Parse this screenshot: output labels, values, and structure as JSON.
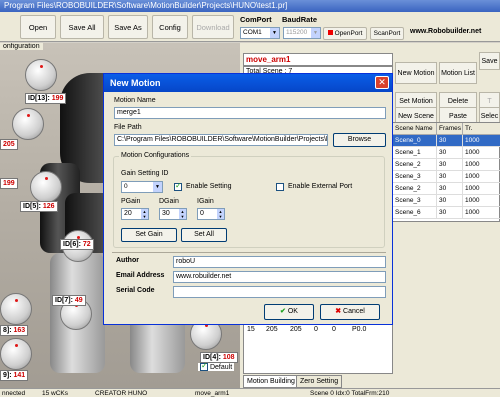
{
  "window": {
    "title": "Program Files\\ROBOBUILDER\\Software\\MotionBuilder\\Projects\\HUNO\\test1.pr]"
  },
  "toolbar": {
    "open": "Open",
    "save_all": "Save All",
    "save_as": "Save As",
    "config": "Config",
    "download": "Download",
    "comport_label": "ComPort",
    "baudrate_label": "BaudRate",
    "comport_value": "COM1",
    "baudrate_value": "115200",
    "open_port": "OpenPort",
    "scan_port": "ScanPort",
    "website": "www.Robobuilder.net"
  },
  "robot": {
    "config_label": "onfiguration",
    "servos": [
      {
        "id": "ID[13]",
        "value": "199"
      },
      {
        "id": "ID[5]",
        "value": "126"
      },
      {
        "id": "ID[6]",
        "value": "72"
      },
      {
        "id": "ID[7]",
        "value": "49"
      },
      {
        "id": "]",
        "value": "199"
      },
      {
        "id": "]",
        "value": "205"
      },
      {
        "id": "8]",
        "value": "163"
      },
      {
        "id": "9]",
        "value": "141"
      },
      {
        "id": "ID[4]",
        "value": "108"
      }
    ],
    "default_label": "Default"
  },
  "motion": {
    "name": "move_arm1",
    "total_scene": "Total Scene : 7",
    "buttons": {
      "new_motion": "New Motion",
      "motion_list": "Motion List",
      "save": "Save",
      "set_motion": "Set Motion",
      "delete": "Delete",
      "t": "T",
      "new_scene": "New Scene",
      "paste": "Paste",
      "select": "Selec"
    },
    "grid": {
      "headers": [
        "Scene Name",
        "Frames",
        "Tr. Time[ms]"
      ],
      "rows": [
        [
          "Scene_0",
          "30",
          "1000"
        ],
        [
          "Scene_1",
          "30",
          "1000"
        ],
        [
          "Scene_2",
          "30",
          "1000"
        ],
        [
          "Scene_3",
          "30",
          "1000"
        ],
        [
          "Scene_2",
          "30",
          "1000"
        ],
        [
          "Scene_3",
          "30",
          "1000"
        ],
        [
          "Scene_6",
          "30",
          "1000"
        ]
      ]
    },
    "lower_row": [
      "15",
      "205",
      "205",
      "0",
      "0",
      "P0.0"
    ],
    "tabs": [
      "Motion Building",
      "Zero Setting"
    ]
  },
  "status": {
    "items": [
      "nnected",
      "15 wCKs",
      "CREATOR  HUNO",
      "move_arm1",
      "Scene  0  Idx:0  TotalFrm:210"
    ]
  },
  "dialog": {
    "title": "New Motion",
    "motion_name_label": "Motion Name",
    "motion_name_value": "merge1",
    "file_path_label": "File Path",
    "file_path_value": "C:\\Program Files\\ROBOBUILDER\\Software\\MotionBuilder\\Projects\\H",
    "browse": "Browse",
    "config_group": "Motion Configurations",
    "gain_setting_id_label": "Gain Setting ID",
    "gain_setting_id_value": "0",
    "enable_setting": "Enable Setting",
    "enable_external_port": "Enable External Port",
    "pgain_label": "PGain",
    "dgain_label": "DGain",
    "igain_label": "IGain",
    "pgain_value": "20",
    "dgain_value": "30",
    "igain_value": "0",
    "set_gain": "Set Gain",
    "set_all": "Set All",
    "author_label": "Author",
    "author_value": "roboU",
    "email_label": "Email Address",
    "email_value": "www.robuilder.net",
    "serial_label": "Serial Code",
    "serial_value": "",
    "ok": "OK",
    "cancel": "Cancel",
    "accent": "#0a5ee8"
  }
}
